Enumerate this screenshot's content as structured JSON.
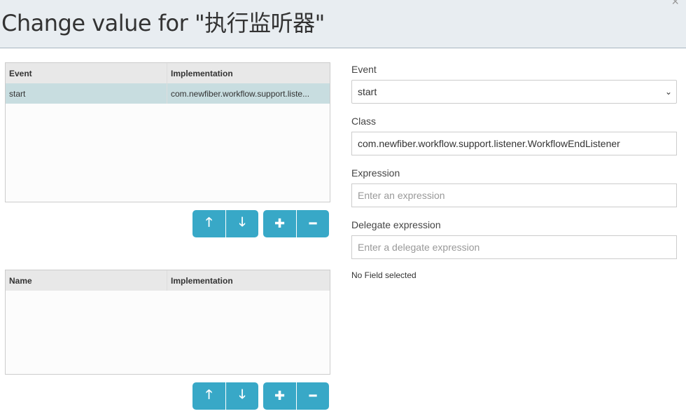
{
  "dialog": {
    "title": "Change value for \"执行监听器\"",
    "close_icon": "close-icon"
  },
  "listeners_table": {
    "headers": [
      "Event",
      "Implementation"
    ],
    "rows": [
      {
        "event": "start",
        "implementation": "com.newfiber.workflow.support.liste..."
      }
    ]
  },
  "fields_table": {
    "headers": [
      "Name",
      "Implementation"
    ],
    "rows": []
  },
  "buttons": {
    "up_icon": "arrow-up-icon",
    "down_icon": "arrow-down-icon",
    "add_icon": "plus-icon",
    "remove_icon": "minus-icon",
    "color": "#38a8c7"
  },
  "form": {
    "event_label": "Event",
    "event_value": "start",
    "class_label": "Class",
    "class_value": "com.newfiber.workflow.support.listener.WorkflowEndListener",
    "expression_label": "Expression",
    "expression_placeholder": "Enter an expression",
    "delegate_label": "Delegate expression",
    "delegate_placeholder": "Enter a delegate expression",
    "no_field": "No Field selected"
  }
}
